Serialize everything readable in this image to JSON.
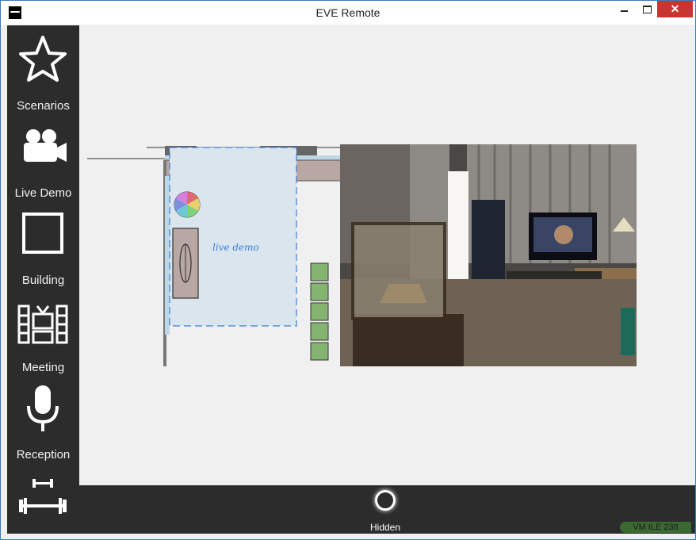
{
  "window": {
    "title": "EVE Remote",
    "close_glyph": "✕"
  },
  "sidebar": {
    "items": [
      {
        "label": "Scenarios",
        "icon": "star-icon"
      },
      {
        "label": "Live Demo",
        "icon": "camera-icon"
      },
      {
        "label": "Building",
        "icon": "square-icon"
      },
      {
        "label": "Meeting",
        "icon": "tv-icon"
      },
      {
        "label": "Reception",
        "icon": "microphone-icon"
      },
      {
        "label": "",
        "icon": "dumbbell-icon"
      }
    ]
  },
  "floorplan": {
    "room_label": "live demo"
  },
  "bottombar": {
    "hidden_label": "Hidden",
    "status": "VM ILE 238"
  },
  "colors": {
    "panel": "#2c2c2c",
    "content_bg": "#f0f0f0",
    "close": "#c7372f",
    "status": "#3b6a31"
  }
}
